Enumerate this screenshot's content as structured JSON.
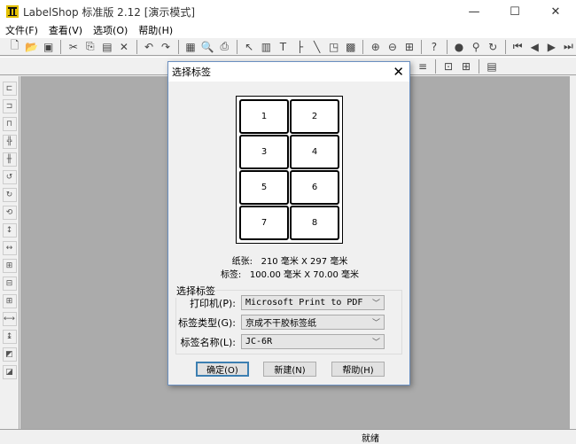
{
  "window": {
    "title": "LabelShop 标准版 2.12 [演示模式]",
    "minimize": "—",
    "maximize": "☐",
    "close": "✕"
  },
  "menu": [
    "文件(F)",
    "查看(V)",
    "选项(O)",
    "帮助(H)"
  ],
  "toolbar_icons": [
    "new-icon",
    "open-icon",
    "save-icon",
    "cut-icon",
    "copy-icon",
    "paste-icon",
    "delete-icon",
    "undo-icon",
    "redo-icon",
    "page-setup-icon",
    "print-preview-icon",
    "print-icon",
    "select-icon",
    "barcode-icon",
    "text-icon",
    "line-h-icon",
    "line-diag-icon",
    "shape-icon",
    "image-icon",
    "zoom-in-icon",
    "zoom-out-icon",
    "fit-icon",
    "help-icon",
    "database-icon",
    "find-icon",
    "refresh-icon",
    "first-icon",
    "prev-icon",
    "next-icon",
    "last-icon"
  ],
  "dialog": {
    "title": "选择标签",
    "close": "✕",
    "labels": [
      "1",
      "2",
      "3",
      "4",
      "5",
      "6",
      "7",
      "8"
    ],
    "paper_label": "纸张:",
    "paper_value": "210 毫米 X  297 毫米",
    "label_label": "标签:",
    "label_value": "100.00 毫米 X 70.00 毫米",
    "group_title": "选择标签",
    "printer_label": "打印机(P):",
    "printer_value": "Microsoft Print to PDF",
    "type_label": "标签类型(G):",
    "type_value": "京成不干胶标签纸",
    "name_label": "标签名称(L):",
    "name_value": "JC-6R",
    "ok": "确定(O)",
    "new": "新建(N)",
    "help": "帮助(H)"
  },
  "status": "就绪"
}
